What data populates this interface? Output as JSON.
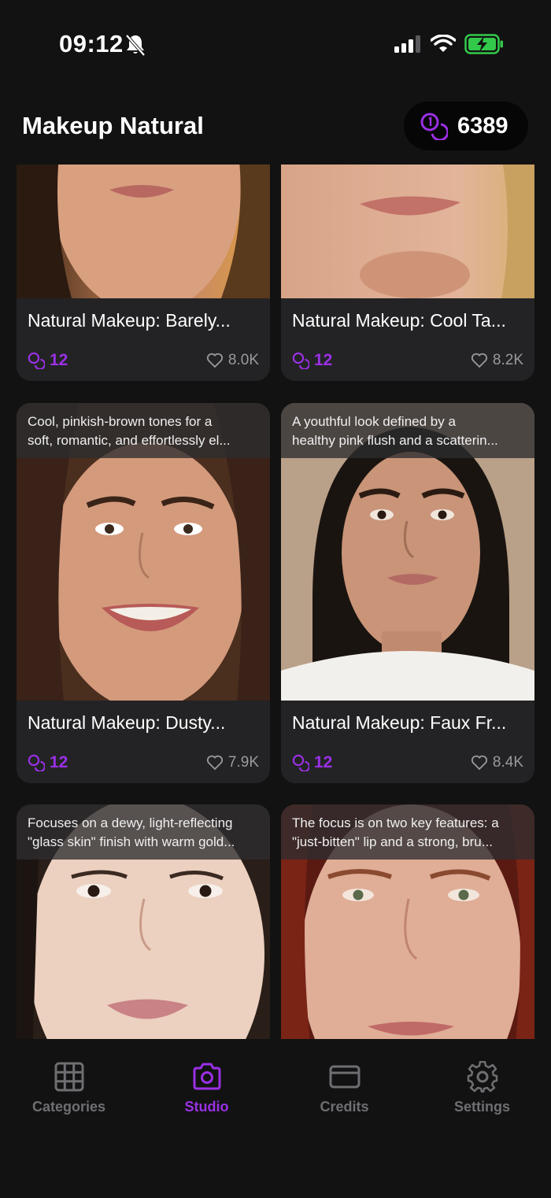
{
  "status_bar": {
    "time": "09:12"
  },
  "header": {
    "title": "Makeup Natural",
    "credits": "6389"
  },
  "colors": {
    "accent": "#9b30e6",
    "background": "#121212",
    "card": "#232325",
    "muted": "#6f6f73"
  },
  "cards": [
    {
      "title": "Natural Makeup: Barely...",
      "cost": "12",
      "likes": "8.0K",
      "description": []
    },
    {
      "title": "Natural Makeup: Cool Ta...",
      "cost": "12",
      "likes": "8.2K",
      "description": []
    },
    {
      "title": "Natural Makeup: Dusty...",
      "cost": "12",
      "likes": "7.9K",
      "description": [
        "Cool, pinkish-brown tones for a",
        "soft, romantic, and effortlessly el..."
      ]
    },
    {
      "title": "Natural Makeup: Faux Fr...",
      "cost": "12",
      "likes": "8.4K",
      "description": [
        "A youthful look defined by a",
        "healthy pink flush and a scatterin..."
      ]
    },
    {
      "title": "",
      "cost": "",
      "likes": "",
      "description": [
        "Focuses on a dewy, light-reflecting",
        "\"glass skin\" finish with warm gold..."
      ]
    },
    {
      "title": "",
      "cost": "",
      "likes": "",
      "description": [
        "The focus is on two key features: a",
        "\"just-bitten\" lip and a strong, bru..."
      ]
    }
  ],
  "tabs": [
    {
      "label": "Categories",
      "icon": "grid-icon",
      "active": false
    },
    {
      "label": "Studio",
      "icon": "camera-icon",
      "active": true
    },
    {
      "label": "Credits",
      "icon": "card-icon",
      "active": false
    },
    {
      "label": "Settings",
      "icon": "gear-icon",
      "active": false
    }
  ]
}
